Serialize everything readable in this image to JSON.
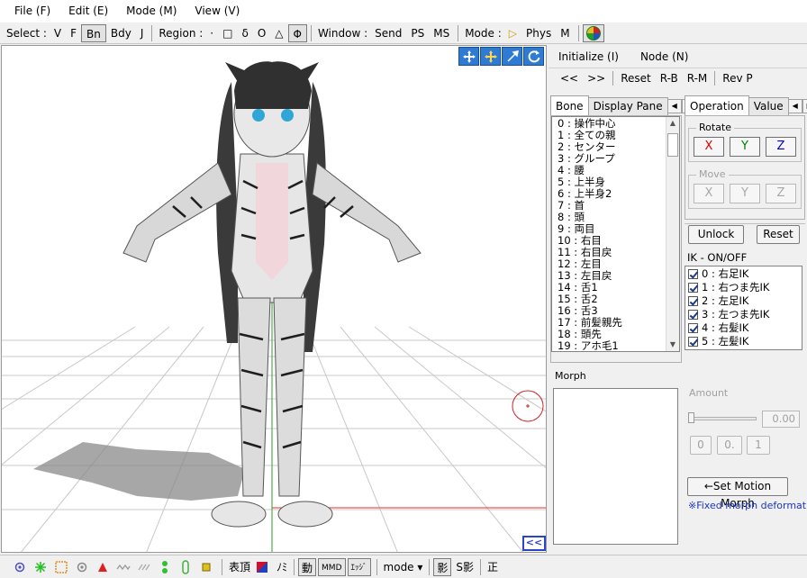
{
  "menu": [
    "File (F)",
    "Edit (E)",
    "Mode (M)",
    "View (V)"
  ],
  "toolbar": {
    "select_label": "Select :",
    "select_items": [
      "V",
      "F",
      "Bn",
      "Bdy",
      "J"
    ],
    "region_label": "Region :",
    "region_items": [
      "·",
      "□",
      "δ",
      "O",
      "△",
      "Φ"
    ],
    "window_label": "Window :",
    "window_items": [
      "Send",
      "PS",
      "MS"
    ],
    "mode_label": "Mode :",
    "mode_items": [
      "▷",
      "Phys",
      "M"
    ]
  },
  "panel": {
    "menu": [
      "Initialize (I)",
      "Node (N)"
    ],
    "nav": [
      "<<",
      ">>",
      "Reset",
      "R-B",
      "R-M",
      "Rev P"
    ],
    "bone_tabs": [
      "Bone",
      "Display Pane"
    ],
    "bones": [
      "0 : 操作中心",
      "1 : 全ての親",
      "2 : センター",
      "3 : グループ",
      "4 : 腰",
      "5 : 上半身",
      "6 : 上半身2",
      "7 : 首",
      "8 : 頭",
      "9 : 両目",
      "10 : 右目",
      "11 : 右目戻",
      "12 : 左目",
      "13 : 左目戻",
      "14 : 舌1",
      "15 : 舌2",
      "16 : 舌3",
      "17 : 前髪親先",
      "18 : 頭先",
      "19 : アホ毛1"
    ],
    "op_tabs": [
      "Operation",
      "Value"
    ],
    "rotate_label": "Rotate",
    "move_label": "Move",
    "axes": [
      "X",
      "Y",
      "Z"
    ],
    "unlock": "Unlock",
    "reset": "Reset",
    "ik_label": "IK - ON/OFF",
    "ik_items": [
      "0 : 右足IK",
      "1 : 右つま先IK",
      "2 : 左足IK",
      "3 : 左つま先IK",
      "4 : 右髪IK",
      "5 : 左髪IK"
    ],
    "morph_label": "Morph",
    "amount_label": "Amount",
    "amount_value": "0.00",
    "amount_buttons": [
      "0",
      "0.",
      "1"
    ],
    "set_motion_morph": "←Set Motion Morph",
    "fixed_morph": "※Fixed morph deformation"
  },
  "viewport": {
    "collapse": "<<"
  },
  "status": {
    "text_items": [
      "表頂",
      "ﾉﾐ"
    ],
    "boxed_items": [
      "動",
      "MMD",
      "ｴｯｼﾞ"
    ],
    "mode": "mode ▾",
    "shadow": "影",
    "s_shadow": "S影",
    "sei": "正"
  },
  "colors": {
    "x_axis": "#d40000",
    "y_axis": "#008000",
    "z_axis": "#0000c0",
    "nav_icon": "#2f7ad3"
  }
}
